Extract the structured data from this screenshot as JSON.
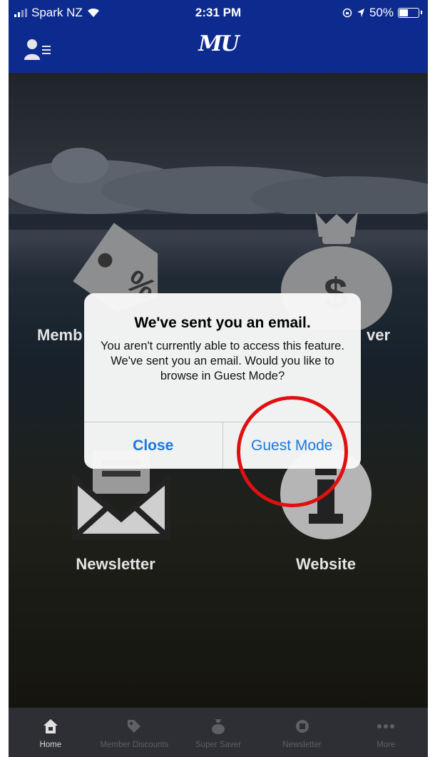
{
  "status_bar": {
    "carrier": "Spark NZ",
    "time": "2:31 PM",
    "battery": "50%",
    "battery_level": 0.5
  },
  "header": {
    "logo": "MU"
  },
  "tiles": [
    {
      "label": "Member Discounts",
      "visible_text": "Memb"
    },
    {
      "label": "Super Saver",
      "visible_text": "ver"
    },
    {
      "label": "Newsletter"
    },
    {
      "label": "Website"
    }
  ],
  "alert": {
    "title": "We've sent you an email.",
    "message": "You aren't currently able to access this feature. We've sent you an email. Would you like to browse in Guest Mode?",
    "close_label": "Close",
    "guest_label": "Guest Mode"
  },
  "tabbar": {
    "items": [
      {
        "label": "Home",
        "icon": "home-icon",
        "active": true
      },
      {
        "label": "Member Discounts",
        "icon": "tag-icon",
        "active": false
      },
      {
        "label": "Super Saver",
        "icon": "money-bag-icon",
        "active": false
      },
      {
        "label": "Newsletter",
        "icon": "newsletter-icon",
        "active": false
      },
      {
        "label": "More",
        "icon": "more-icon",
        "active": false
      }
    ]
  },
  "colors": {
    "header": "#0d2b8f",
    "alert_button": "#1a78e0",
    "highlight_ring": "#e01010",
    "tabbar": "#2e2f34"
  }
}
